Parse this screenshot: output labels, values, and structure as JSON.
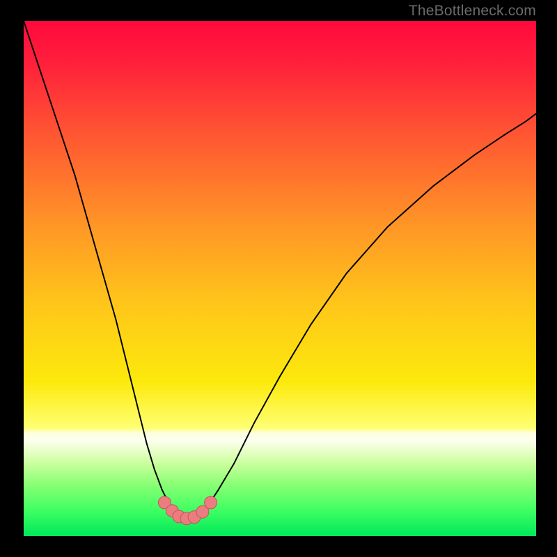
{
  "watermark": "TheBottleneck.com",
  "gradient_stops": [
    {
      "offset": 0.0,
      "color": "#ff0a3d"
    },
    {
      "offset": 0.08,
      "color": "#ff1f3b"
    },
    {
      "offset": 0.22,
      "color": "#ff5632"
    },
    {
      "offset": 0.4,
      "color": "#ff9726"
    },
    {
      "offset": 0.55,
      "color": "#ffc61a"
    },
    {
      "offset": 0.7,
      "color": "#fce90c"
    },
    {
      "offset": 0.79,
      "color": "#ffff73"
    },
    {
      "offset": 0.8,
      "color": "#fdffe0"
    },
    {
      "offset": 0.815,
      "color": "#fbffee"
    },
    {
      "offset": 0.83,
      "color": "#edffd0"
    },
    {
      "offset": 0.86,
      "color": "#c8ff9c"
    },
    {
      "offset": 0.9,
      "color": "#89ff75"
    },
    {
      "offset": 0.95,
      "color": "#3fff62"
    },
    {
      "offset": 1.0,
      "color": "#00e85a"
    }
  ],
  "curve_stroke": "#000000",
  "curve_width": 2,
  "marker_fill": "#ec7c80",
  "marker_stroke": "#bf575c",
  "marker_radius": 9,
  "chart_data": {
    "type": "line",
    "title": "",
    "xlabel": "",
    "ylabel": "",
    "xlim": [
      0,
      100
    ],
    "ylim": [
      0,
      100
    ],
    "note": "No axis or tick labels visible; values expressed as percent of plot width/height. Curves are approximate smooth fits to the on-screen pixels; markers are read directly.",
    "series": [
      {
        "name": "left-curve",
        "x": [
          0,
          2,
          4,
          6,
          8,
          10,
          12,
          14,
          16,
          18,
          20,
          22,
          24,
          25.5,
          27,
          28.5,
          30
        ],
        "y": [
          100,
          94,
          88,
          82,
          76,
          70,
          63,
          56,
          49,
          42,
          34,
          26,
          18,
          13,
          9,
          6,
          4.5
        ]
      },
      {
        "name": "right-curve",
        "x": [
          34,
          36,
          38,
          41,
          45,
          50,
          56,
          63,
          71,
          80,
          88,
          94,
          98,
          100
        ],
        "y": [
          4.5,
          6,
          9,
          14,
          22,
          31,
          41,
          51,
          60,
          68,
          74,
          78,
          80.5,
          82
        ]
      },
      {
        "name": "bottom-arc",
        "x": [
          30,
          31,
          32,
          33,
          34
        ],
        "y": [
          4.5,
          3.7,
          3.5,
          3.7,
          4.5
        ]
      }
    ],
    "markers": [
      {
        "x": 27.5,
        "y": 6.5
      },
      {
        "x": 29.0,
        "y": 4.9
      },
      {
        "x": 30.3,
        "y": 3.8
      },
      {
        "x": 31.8,
        "y": 3.4
      },
      {
        "x": 33.3,
        "y": 3.7
      },
      {
        "x": 34.9,
        "y": 4.7
      },
      {
        "x": 36.5,
        "y": 6.5
      }
    ]
  }
}
